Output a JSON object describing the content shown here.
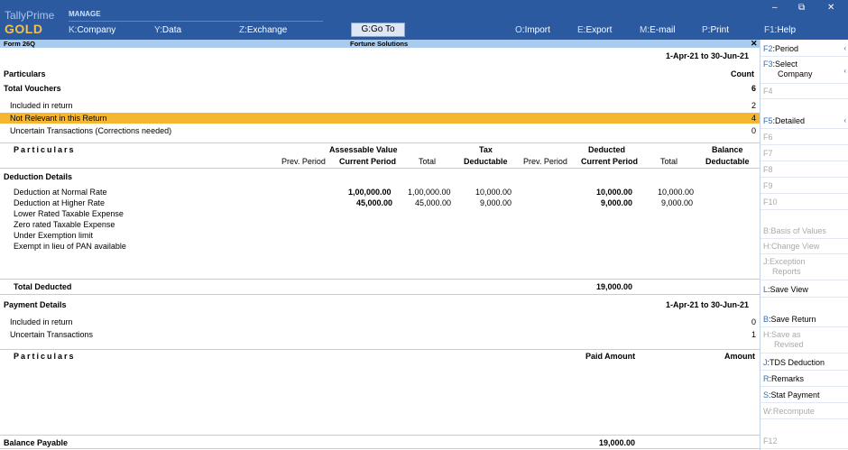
{
  "app": {
    "brand": "TallyPrime",
    "edition": "GOLD",
    "manage_label": "MANAGE"
  },
  "toolbar": {
    "company": {
      "key": "K",
      "label": "Company"
    },
    "data": {
      "key": "Y",
      "label": "Data"
    },
    "exchange": {
      "key": "Z",
      "label": "Exchange"
    },
    "goto": {
      "key": "G",
      "label": "Go To"
    },
    "import": {
      "key": "O",
      "label": "Import"
    },
    "export": {
      "key": "E",
      "label": "Export"
    },
    "email": {
      "key": "M",
      "label": "E-mail"
    },
    "print": {
      "key": "P",
      "label": "Print"
    },
    "help": {
      "key": "F1",
      "label": "Help"
    }
  },
  "window": {
    "minimize": "–",
    "restore": "⧉",
    "close": "✕"
  },
  "subbar": {
    "form": "Form 26Q",
    "company": "Fortune Solutions",
    "close": "✕"
  },
  "report": {
    "period": "1-Apr-21 to 30-Jun-21",
    "particulars": "Particulars",
    "count": "Count",
    "total_vouchers": {
      "label": "Total Vouchers",
      "value": "6"
    },
    "included": {
      "label": "Included in return",
      "value": "2"
    },
    "not_relevant": {
      "label": "Not Relevant in this Return",
      "value": "4"
    },
    "uncertain": {
      "label": "Uncertain Transactions (Corrections needed)",
      "value": "0"
    }
  },
  "ded_table": {
    "particulars": "Particulars",
    "assessable_value": "Assessable Value",
    "tax": "Tax",
    "deductable": "Deductable",
    "deducted": "Deducted",
    "balance": "Balance",
    "balance_deductable": "Deductable",
    "prev_period": "Prev. Period",
    "current_period": "Current Period",
    "total": "Total",
    "section_title": "Deduction Details",
    "rows": [
      {
        "label": "Deduction at Normal Rate",
        "av_cur": "1,00,000.00",
        "av_total": "1,00,000.00",
        "tax": "10,000.00",
        "ded_cur": "10,000.00",
        "ded_total": "10,000.00"
      },
      {
        "label": "Deduction at Higher Rate",
        "av_cur": "45,000.00",
        "av_total": "45,000.00",
        "tax": "9,000.00",
        "ded_cur": "9,000.00",
        "ded_total": "9,000.00"
      },
      {
        "label": "Lower Rated Taxable Expense"
      },
      {
        "label": "Zero rated Taxable Expense"
      },
      {
        "label": "Under Exemption limit"
      },
      {
        "label": "Exempt in lieu of PAN available"
      }
    ],
    "total_deducted": {
      "label": "Total Deducted",
      "value": "19,000.00"
    }
  },
  "payment": {
    "title": "Payment Details",
    "period": "1-Apr-21 to 30-Jun-21",
    "included": {
      "label": "Included in return",
      "value": "0"
    },
    "uncertain": {
      "label": "Uncertain Transactions",
      "value": "1"
    },
    "particulars": "Particulars",
    "paid_amount": "Paid Amount",
    "amount": "Amount"
  },
  "balance_payable": {
    "label": "Balance Payable",
    "value": "19,000.00"
  },
  "sidebar": [
    {
      "key": "F2",
      "label": "Period",
      "enabled": true,
      "arrow": true
    },
    {
      "key": "F3",
      "label": "Select",
      "label2": "Company",
      "enabled": true,
      "arrow": true
    },
    {
      "key": "F4",
      "label": "",
      "enabled": false
    },
    {
      "key": "F5",
      "label": "Detailed",
      "enabled": true,
      "arrow": true
    },
    {
      "key": "F6",
      "label": "",
      "enabled": false
    },
    {
      "key": "F7",
      "label": "",
      "enabled": false
    },
    {
      "key": "F8",
      "label": "",
      "enabled": false
    },
    {
      "key": "F9",
      "label": "",
      "enabled": false
    },
    {
      "key": "F10",
      "label": "",
      "enabled": false
    },
    {
      "key": "B",
      "label": "Basis of Values",
      "enabled": false
    },
    {
      "key": "H",
      "label": "Change View",
      "enabled": false
    },
    {
      "key": "J",
      "label": "Exception",
      "label2": "Reports",
      "enabled": false
    },
    {
      "key": "L",
      "label": "Save View",
      "enabled": true
    },
    {
      "key": "B",
      "label": "Save Return",
      "enabled": true
    },
    {
      "key": "H",
      "label": "Save as",
      "label2": "Revised",
      "enabled": false
    },
    {
      "key": "J",
      "label": "TDS Deduction",
      "enabled": true
    },
    {
      "key": "R",
      "label": "Remarks",
      "enabled": true
    },
    {
      "key": "S",
      "label": "Stat Payment",
      "enabled": true
    },
    {
      "key": "W",
      "label": "Recompute",
      "enabled": false
    },
    {
      "key": "F12",
      "label": "",
      "enabled": false
    }
  ],
  "colors": {
    "topbar": "#2c5aa0",
    "subbar": "#a9cbee",
    "highlight": "#f5b731",
    "brand_gold": "#f2c14e"
  }
}
